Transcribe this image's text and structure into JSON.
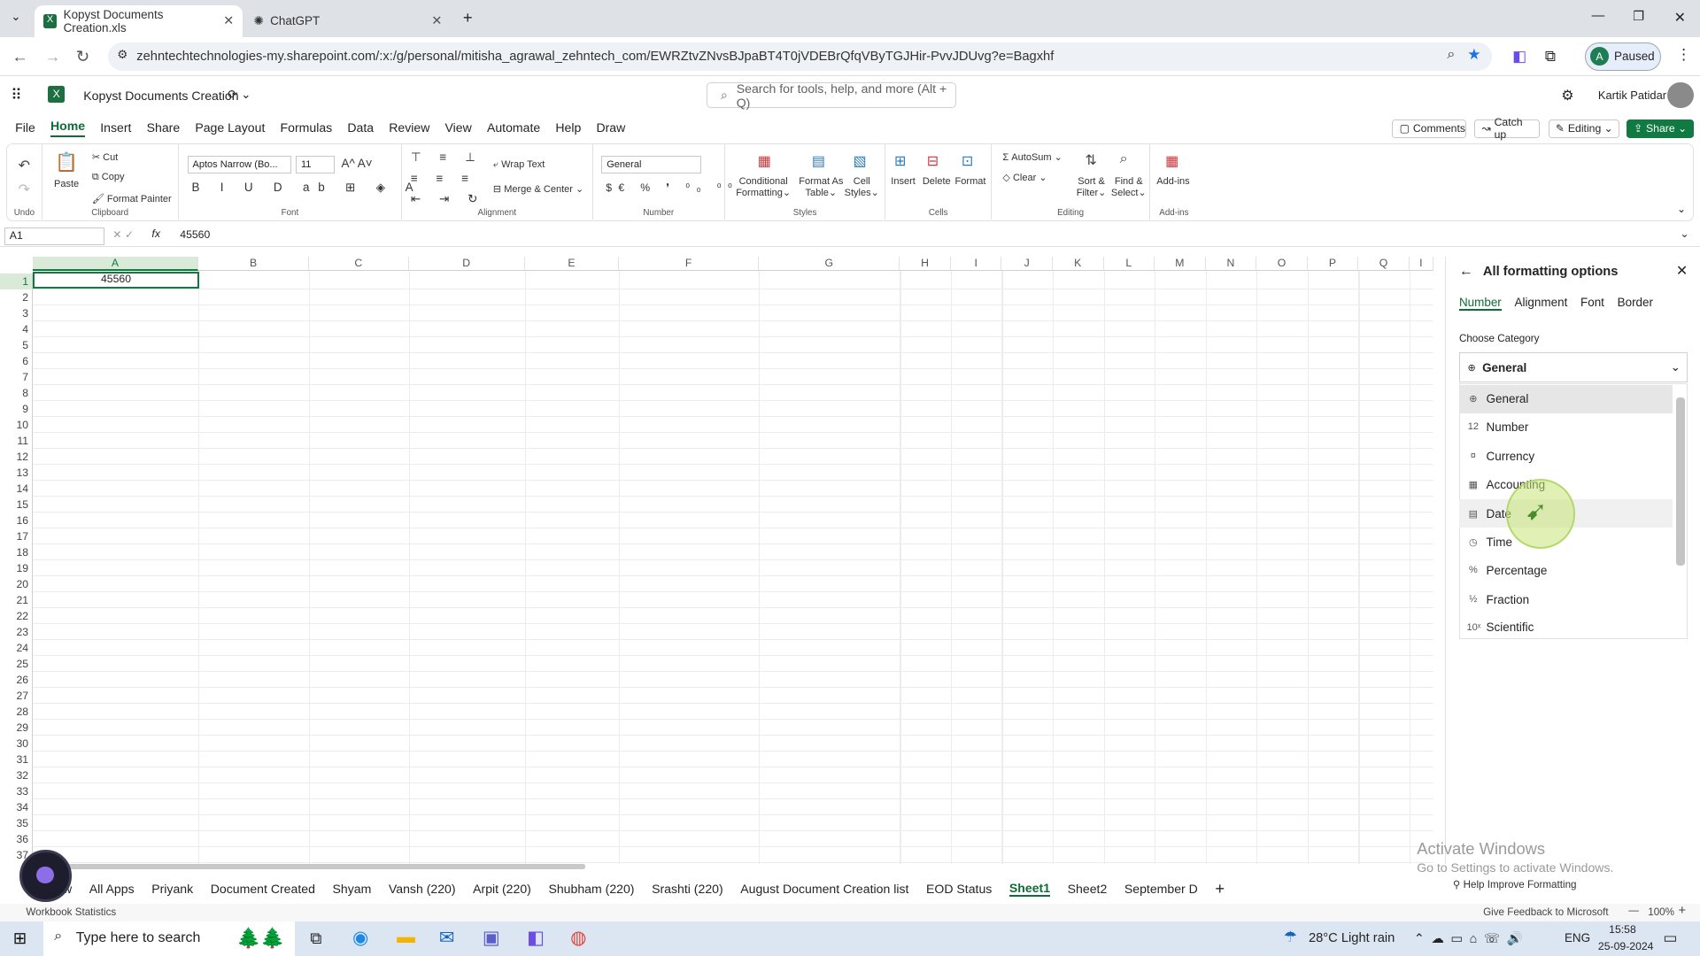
{
  "browser": {
    "tabs": [
      {
        "title": "Kopyst Documents Creation.xls",
        "active": true
      },
      {
        "title": "ChatGPT",
        "active": false
      }
    ],
    "url": "zehntechtechnologies-my.sharepoint.com/:x:/g/personal/mitisha_agrawal_zehntech_com/EWRZtvZNvsBJpaBT4T0jVDEBrQfqVByTGJHir-PvvJDUvg?e=Bagxhf",
    "profile_initial": "A",
    "profile_status": "Paused"
  },
  "app": {
    "doc_title": "Kopyst Documents Creation",
    "search_placeholder": "Search for tools, help, and more (Alt + Q)",
    "user_name": "Kartik Patidar"
  },
  "menu": [
    "File",
    "Home",
    "Insert",
    "Share",
    "Page Layout",
    "Formulas",
    "Data",
    "Review",
    "View",
    "Automate",
    "Help",
    "Draw"
  ],
  "menu_active": "Home",
  "actions": {
    "comments": "Comments",
    "catchup": "Catch up",
    "editing": "Editing",
    "share": "Share"
  },
  "ribbon": {
    "undo": {
      "label": "Undo"
    },
    "clipboard": {
      "paste": "Paste",
      "cut": "Cut",
      "copy": "Copy",
      "format_painter": "Format Painter",
      "label": "Clipboard"
    },
    "font": {
      "name": "Aptos Narrow (Bo...",
      "size": "11",
      "label": "Font"
    },
    "alignment": {
      "wrap": "Wrap Text",
      "merge": "Merge & Center",
      "label": "Alignment"
    },
    "number": {
      "format": "General",
      "label": "Number"
    },
    "styles": {
      "cond1": "Conditional",
      "cond2": "Formatting",
      "fat1": "Format As",
      "fat2": "Table",
      "cs1": "Cell",
      "cs2": "Styles",
      "label": "Styles"
    },
    "cells": {
      "insert": "Insert",
      "delete": "Delete",
      "format": "Format",
      "label": "Cells"
    },
    "editing": {
      "autosum": "AutoSum",
      "clear": "Clear",
      "sort1": "Sort &",
      "sort2": "Filter",
      "find1": "Find &",
      "find2": "Select",
      "label": "Editing"
    },
    "addins": {
      "name": "Add-ins",
      "label": "Add-ins"
    }
  },
  "formula_bar": {
    "name_box": "A1",
    "value": "45560"
  },
  "grid": {
    "columns": [
      "A",
      "B",
      "C",
      "D",
      "E",
      "F",
      "G",
      "H",
      "I",
      "J",
      "K",
      "L",
      "M",
      "N",
      "O",
      "P",
      "Q",
      "I"
    ],
    "rows": [
      "1",
      "2",
      "3",
      "4",
      "5",
      "6",
      "7",
      "8",
      "9",
      "10",
      "11",
      "12",
      "13",
      "14",
      "15",
      "16",
      "17",
      "18",
      "19",
      "20",
      "21",
      "22",
      "23",
      "24",
      "25",
      "26",
      "27",
      "28",
      "29",
      "30",
      "31",
      "32",
      "33",
      "34",
      "35",
      "36",
      "37"
    ],
    "cell_a1": "45560"
  },
  "panel": {
    "title": "All formatting options",
    "tabs": [
      "Number",
      "Alignment",
      "Font",
      "Border"
    ],
    "active_tab": "Number",
    "choose_category": "Choose Category",
    "selected": "General",
    "categories": [
      {
        "name": "General",
        "icon": "general-icon"
      },
      {
        "name": "Number",
        "icon": "number-icon"
      },
      {
        "name": "Currency",
        "icon": "currency-icon"
      },
      {
        "name": "Accounting",
        "icon": "accounting-icon"
      },
      {
        "name": "Date",
        "icon": "calendar-icon"
      },
      {
        "name": "Time",
        "icon": "clock-icon"
      },
      {
        "name": "Percentage",
        "icon": "percent-icon"
      },
      {
        "name": "Fraction",
        "icon": "fraction-icon"
      },
      {
        "name": "Scientific",
        "icon": "scientific-icon"
      }
    ],
    "help": "Help Improve Formatting"
  },
  "watermark": {
    "line1": "Activate Windows",
    "line2": "Go to Settings to activate Windows."
  },
  "sheet_tabs": [
    "w",
    "All Apps",
    "Priyank",
    "Document Created",
    "Shyam",
    "Vansh (220)",
    "Arpit (220)",
    "Shubham (220)",
    "Srashti (220)",
    "August Document Creation list",
    "EOD Status",
    "Sheet1",
    "Sheet2",
    "September D"
  ],
  "active_sheet": "Sheet1",
  "status": {
    "left": "Workbook Statistics",
    "feedback": "Give Feedback to Microsoft",
    "zoom": "100%"
  },
  "taskbar": {
    "search_placeholder": "Type here to search",
    "weather": "28°C  Light rain",
    "lang": "ENG",
    "time": "15:58",
    "date": "25-09-2024"
  }
}
